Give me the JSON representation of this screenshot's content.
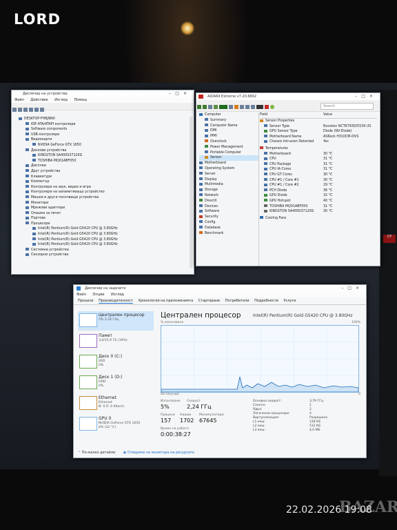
{
  "photo": {
    "watermark": "LORD",
    "timestamp": "22.02.2026 19:08",
    "site_mark": "BAZAR"
  },
  "device_manager": {
    "title": "Диспечер на устройства",
    "menu": [
      "Файл",
      "Действие",
      "Изглед",
      "Помощ"
    ],
    "items": [
      "DESKTOP-FH6JNN0",
      "IDE ATA/ATAPI контролери",
      "Software components",
      "USB контролери",
      "Видеокарти",
      "NVIDIA GeForce GTX 1650",
      "Дискови устройства",
      "KINGSTON SA400S37120G",
      "TOSHIBA MQ01ABF050",
      "Дисплеи",
      "Друг устройства",
      "Клавиатури",
      "Компютър",
      "Контролери на звук, видео и игри",
      "Контролери на запаметяващо устройство",
      "Мишки и други посочващи устройства",
      "Монитори",
      "Мрежови адаптери",
      "Опашки за печат",
      "Портове",
      "Процесори",
      "Intel(R) Pentium(R) Gold G5420 CPU @ 3.80GHz",
      "Intel(R) Pentium(R) Gold G5420 CPU @ 3.80GHz",
      "Intel(R) Pentium(R) Gold G5420 CPU @ 3.80GHz",
      "Intel(R) Pentium(R) Gold G5420 CPU @ 3.80GHz",
      "Системни устройства",
      "Сензорни устройства"
    ]
  },
  "aida": {
    "title": "AIDA64 Extreme v7.20.6802",
    "search_placeholder": "Search",
    "tree": [
      "Computer",
      "Summary",
      "Computer Name",
      "DMI",
      "IPMI",
      "Overclock",
      "Power Management",
      "Portable Computer",
      "Sensor",
      "Motherboard",
      "Operating System",
      "Server",
      "Display",
      "Multimedia",
      "Storage",
      "Network",
      "DirectX",
      "Devices",
      "Software",
      "Security",
      "Config",
      "Database",
      "Benchmark"
    ],
    "col_field": "Field",
    "col_value": "Value",
    "sensor_props_header": "Sensor Properties",
    "sensor_props": [
      {
        "field": "Sensor Type",
        "value": "Nuvoton NCT6793D/5539 (IS"
      },
      {
        "field": "GPU Sensor Type",
        "value": "Diode (NV-Diode)"
      },
      {
        "field": "Motherboard Name",
        "value": "ASRock H310CM-DVS"
      },
      {
        "field": "Chassis Intrusion Detected",
        "value": "Yes"
      }
    ],
    "temperatures_header": "Temperatures",
    "temperatures": [
      {
        "field": "Motherboard",
        "value": "30 °C"
      },
      {
        "field": "CPU",
        "value": "31 °C"
      },
      {
        "field": "CPU Package",
        "value": "31 °C"
      },
      {
        "field": "CPU IA Cores",
        "value": "31 °C"
      },
      {
        "field": "CPU GT Cores",
        "value": "30 °C"
      },
      {
        "field": "CPU #1 / Core #1",
        "value": "30 °C"
      },
      {
        "field": "CPU #1 / Core #2",
        "value": "29 °C"
      },
      {
        "field": "PCH Diode",
        "value": "36 °C"
      },
      {
        "field": "GPU Diode",
        "value": "32 °C"
      },
      {
        "field": "GPU Hotspot",
        "value": "40 °C"
      },
      {
        "field": "TOSHIBA MQ01ABF050",
        "value": "31 °C"
      },
      {
        "field": "KINGSTON SA400S37120G",
        "value": "30 °C"
      }
    ],
    "cooling_fans_header": "Cooling Fans"
  },
  "task_manager": {
    "title": "Диспечер на задачите",
    "menu": [
      "Файл",
      "Опции",
      "Изглед"
    ],
    "tabs": [
      "Процеси",
      "Производителност",
      "Хронология на приложенията",
      "Стартиране",
      "Потребители",
      "Подробности",
      "Услуги"
    ],
    "side": [
      {
        "name": "Централен процесор",
        "sub": "5% 2,24 ГХц",
        "sub2": ""
      },
      {
        "name": "Памет",
        "sub": "3,0/15,9 ГБ (19%)",
        "sub2": ""
      },
      {
        "name": "Диск 0 (C:)",
        "sub": "SSD",
        "sub2": "0%"
      },
      {
        "name": "Диск 1 (D:)",
        "sub": "HDD",
        "sub2": "0%"
      },
      {
        "name": "Ethernet",
        "sub": "Ethernet",
        "sub2": "И: 0 П: 0 Кбит/с"
      },
      {
        "name": "GPU 0",
        "sub": "NVIDIA GeForce GTX 1650",
        "sub2": "4% (32 °C)"
      }
    ],
    "cpu_title": "Централен процесор",
    "cpu_model": "Intel(R) Pentium(R) Gold G5420 CPU @ 3.80GHz",
    "graph_label": "% използване",
    "graph_max": "100%",
    "graph_time": "60 секунди",
    "graph_min": "0",
    "usage_label": "Използване",
    "usage_value": "5%",
    "speed_label": "Скорост",
    "speed_value": "2,24 ГГц",
    "processes_label": "Процеси",
    "processes_value": "157",
    "threads_label": "Нишки",
    "threads_value": "1702",
    "handles_label": "Манипулатори",
    "handles_value": "67645",
    "uptime_label": "Време на работа",
    "uptime_value": "0:00:38:27",
    "details": [
      {
        "k": "Основна скорост:",
        "v": "3,79 ГГц"
      },
      {
        "k": "Сокети:",
        "v": "1"
      },
      {
        "k": "Ядра:",
        "v": "2"
      },
      {
        "k": "Логически процесори:",
        "v": "4"
      },
      {
        "k": "Виртуализация:",
        "v": "Разрешено"
      },
      {
        "k": "L1 кеш:",
        "v": "128 КБ"
      },
      {
        "k": "L2 кеш:",
        "v": "512 КБ"
      },
      {
        "k": "L3 кеш:",
        "v": "4,0 МБ"
      }
    ],
    "footer_less": "По-малко детайли",
    "footer_monitor": "Отваряне на монитора на ресурсите"
  },
  "colors": {
    "accent": "#1a73c9",
    "graph_line": "#1769b8",
    "window_bg": "#f4f5f6"
  }
}
